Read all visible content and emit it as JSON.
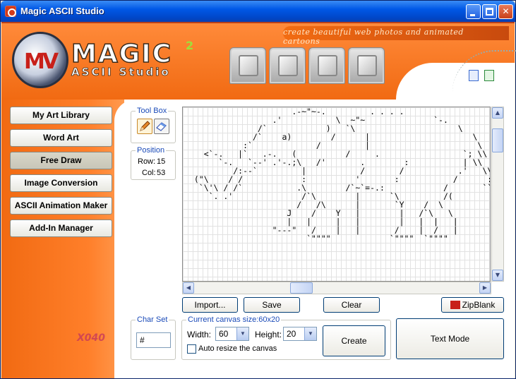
{
  "window": {
    "title": "Magic ASCII Studio",
    "minimize_glyph": "_",
    "close_glyph": "✕"
  },
  "header": {
    "tagline": "create beautiful web photos and animated cartoons",
    "logo_text": "MAGIC",
    "logo_superscript": "2",
    "logo_subtext": "ASCII Studio",
    "logo_emblem_text": "MV",
    "tool_tabs": [
      "draw-tool-tab",
      "layers-tool-tab",
      "pages-tool-tab",
      "edit-tool-tab"
    ]
  },
  "nav": {
    "items": [
      {
        "label": "My Art Library"
      },
      {
        "label": "Word Art"
      },
      {
        "label": "Free Draw",
        "active": true
      },
      {
        "label": "Image Conversion"
      },
      {
        "label": "ASCII Animation Maker"
      },
      {
        "label": "Add-In Manager"
      }
    ]
  },
  "brand_mark": "X040",
  "toolbox": {
    "label": "Tool Box",
    "tools": [
      "pencil-icon",
      "eraser-icon"
    ]
  },
  "position": {
    "label": "Position",
    "row_label": "Row:",
    "row_value": "15",
    "col_label": "Col:",
    "col_value": "53"
  },
  "canvas": {
    "ascii": "                      .-~\"~-.         . . . .\n                  .'           \\  ~\"~              `-.\n               /`            )   `\\                     \\\n              /`    a)        /      |                     \\\n            :`             /         |                      \\\n    <`-.   |`   .-.   (          /     .                 `; \\\\\n       `-.   `--' .'-.;\\   /'       .        :           | \\\\\n          /:--`         |           /       /           .'   \\\\\n  (\"\\    / /            :          '       :           /      :\n   `\\'\\ / /`           .\\        /`~`=-.:            /       ``\n     `. .'              /`\\        |      `\\         /(\n                       /   /\\      |       `Y    /  \\\n                     J    /    Y   |        |   /`\\   \\\n                     |   |     |   |        |   |  |   |\n                  \"---\"   /    |   |       /    |  /   |\n                         `\"\"\"\"            `\"\"\"\"  `\"\"\"\"",
    "arrow_up": "▲",
    "arrow_down": "▼",
    "arrow_left": "◀",
    "arrow_right": "▶"
  },
  "buttons": {
    "import": "Import...",
    "save": "Save",
    "clear": "Clear",
    "zipblank": "ZipBlank",
    "create": "Create",
    "text_mode": "Text Mode"
  },
  "charset": {
    "label": "Char Set",
    "value": "#"
  },
  "canvas_size": {
    "label": "Current canvas size:60x20",
    "width_label": "Width:",
    "width_value": "60",
    "height_label": "Height:",
    "height_value": "20",
    "auto_resize_label": "Auto resize the canvas",
    "auto_resize_checked": false
  },
  "colors": {
    "accent_orange": "#f16a12",
    "title_blue": "#0058e6",
    "label_blue": "#1a4ab8"
  }
}
